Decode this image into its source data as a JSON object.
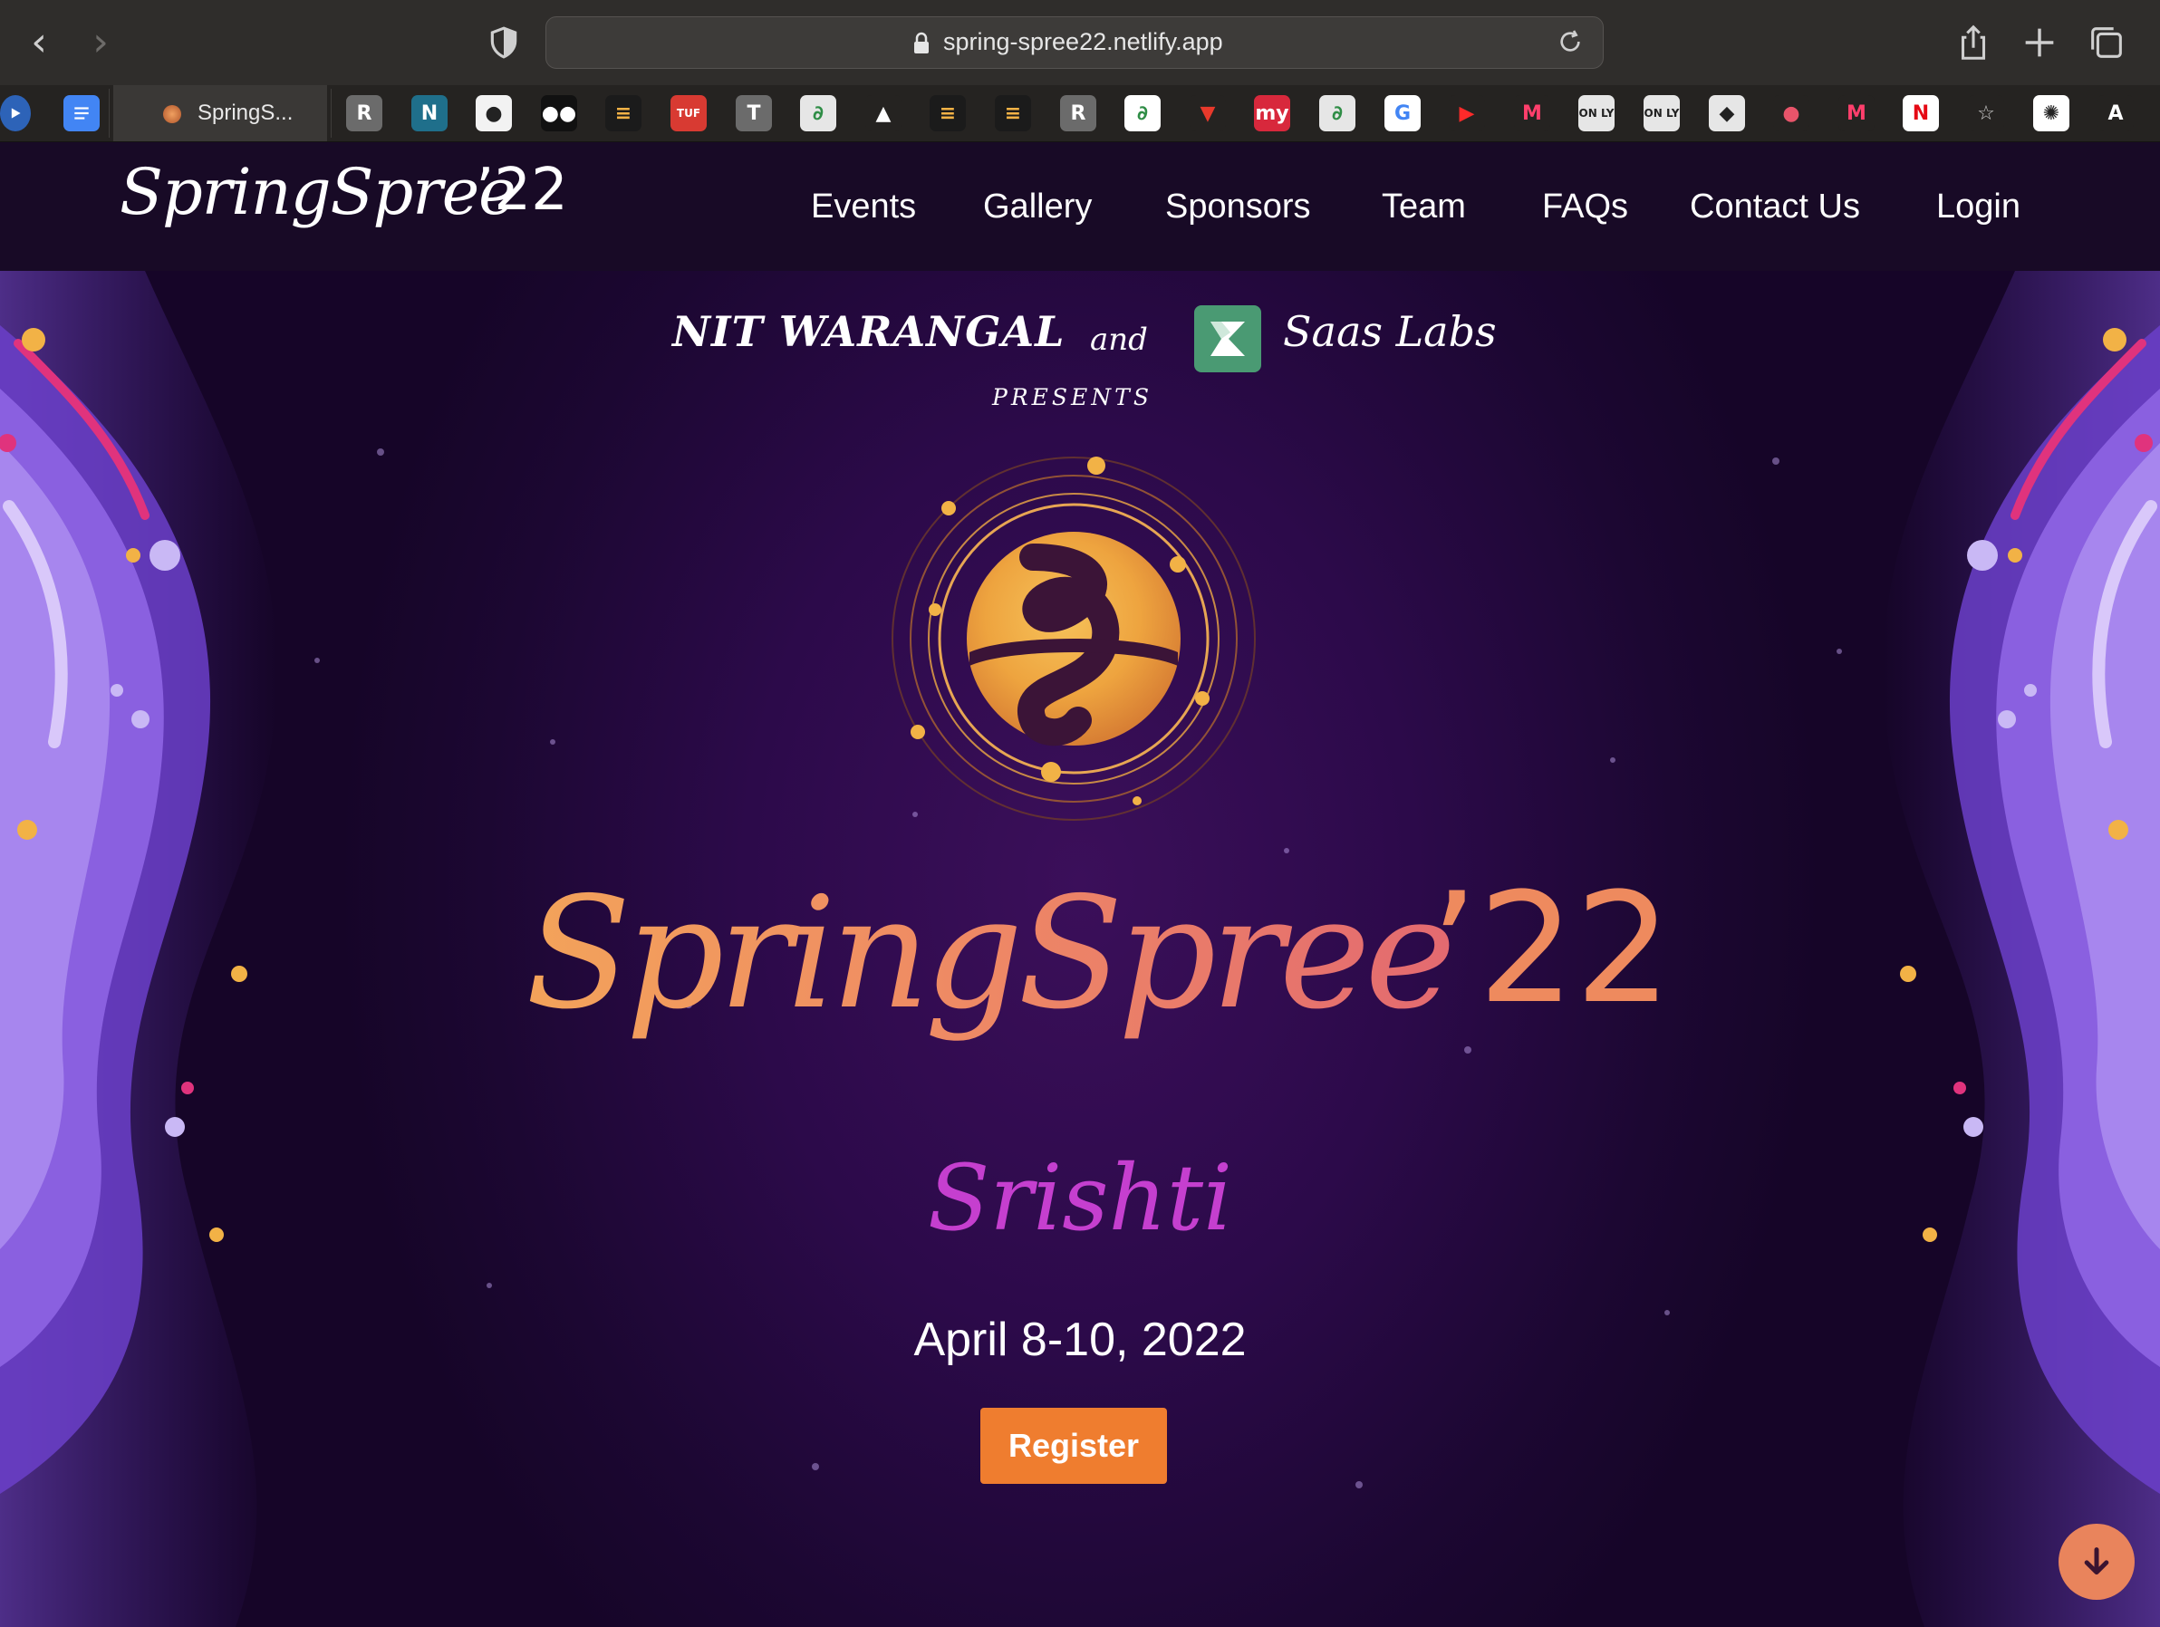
{
  "browser": {
    "url": "spring-spree22.netlify.app",
    "active_tab_title": "SpringS..."
  },
  "bookmarks": [
    {
      "icon": "play-icon",
      "color": "#2d63b8"
    },
    {
      "icon": "google-docs-icon",
      "color": "#4285f4"
    },
    {
      "icon": "r-icon",
      "label": "R",
      "color": "#6b6b6b"
    },
    {
      "icon": "n-icon",
      "label": "N",
      "color": "#1f6f8b"
    },
    {
      "icon": "github-icon",
      "color": "#f2f2f2"
    },
    {
      "icon": "medium-icon",
      "color": "#111111"
    },
    {
      "icon": "hackerrank-icon",
      "color": "#1b1b1b"
    },
    {
      "icon": "tuf-icon",
      "label": "TUF",
      "color": "#d83a32"
    },
    {
      "icon": "t-icon",
      "label": "T",
      "color": "#6b6b6b"
    },
    {
      "icon": "geeksforgeeks-icon",
      "color": "#e6e6e6"
    },
    {
      "icon": "rocket-icon",
      "color": "#252321"
    },
    {
      "icon": "hackerrank-icon",
      "color": "#1b1b1b"
    },
    {
      "icon": "hackerrank-icon",
      "color": "#1b1b1b"
    },
    {
      "icon": "r-icon",
      "label": "R",
      "color": "#6b6b6b"
    },
    {
      "icon": "geeksforgeeks-icon",
      "color": "#ffffff"
    },
    {
      "icon": "v-icon",
      "color": "#252321"
    },
    {
      "icon": "my-icon",
      "label": "my",
      "color": "#d8283c"
    },
    {
      "icon": "geeksforgeeks-icon",
      "color": "#e6e6e6"
    },
    {
      "icon": "google-icon",
      "color": "#ffffff"
    },
    {
      "icon": "youtube-icon",
      "color": "#252321"
    },
    {
      "icon": "myntra-icon",
      "color": "#252321"
    },
    {
      "icon": "only-icon",
      "label": "ON LY",
      "color": "#e6e6e6"
    },
    {
      "icon": "only-icon",
      "label": "ON LY",
      "color": "#e6e6e6"
    },
    {
      "icon": "diamond-icon",
      "color": "#e6e6e6"
    },
    {
      "icon": "circles-icon",
      "color": "#252321"
    },
    {
      "icon": "myntra-icon",
      "color": "#252321"
    },
    {
      "icon": "netflix-icon",
      "label": "N",
      "color": "#ffffff"
    },
    {
      "icon": "star-icon",
      "color": "#252321"
    },
    {
      "icon": "openai-icon",
      "color": "#ffffff"
    },
    {
      "icon": "a-icon",
      "label": "A",
      "color": "#252321"
    }
  ],
  "site": {
    "logo_script": "SpringSpree",
    "logo_num": "’22",
    "nav": [
      {
        "label": "Events"
      },
      {
        "label": "Gallery"
      },
      {
        "label": "Sponsors"
      },
      {
        "label": "Team"
      },
      {
        "label": "FAQs"
      },
      {
        "label": "Contact Us"
      },
      {
        "label": "Login"
      }
    ]
  },
  "hero": {
    "org": "NIT WARANGAL",
    "and": "and",
    "sponsor": "Saas Labs",
    "presents": "PRESENTS",
    "title_script": "SpringSpree",
    "title_num": "’22",
    "subtitle": "Srishti",
    "dates": "April 8-10, 2022",
    "register_label": "Register"
  },
  "colors": {
    "accent": "#ef7d2f",
    "title_gradient_start": "#f3a35a",
    "title_gradient_end": "#e36a70",
    "subtitle": "#c53fcf",
    "navbar": "#180a26"
  }
}
